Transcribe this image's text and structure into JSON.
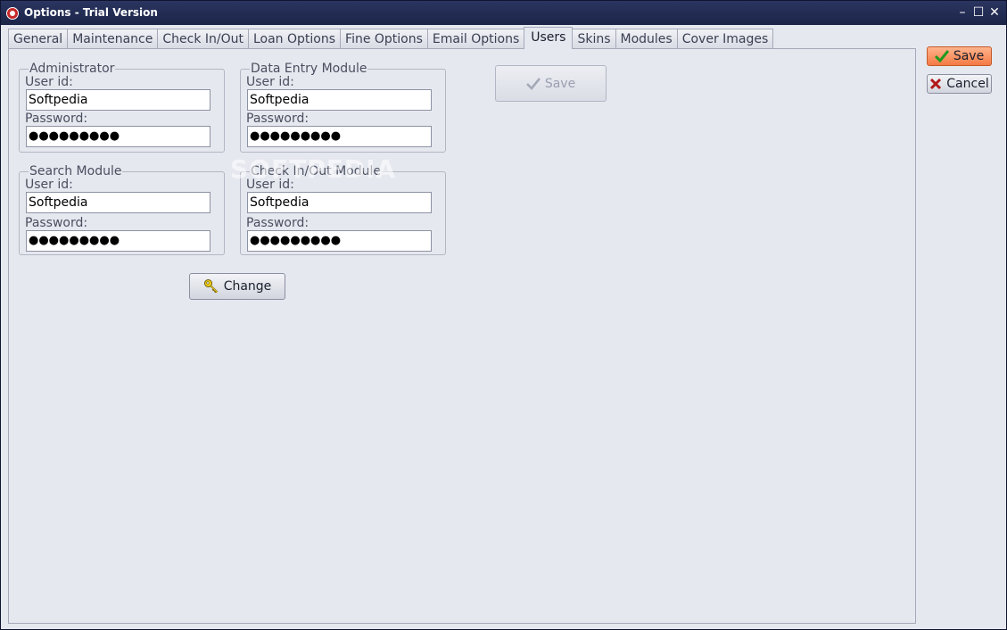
{
  "window": {
    "title": "Options - Trial Version",
    "controls": {
      "minimize": "–",
      "maximize": "☐",
      "close": "✕"
    }
  },
  "tabs": [
    {
      "label": "General"
    },
    {
      "label": "Maintenance"
    },
    {
      "label": "Check In/Out"
    },
    {
      "label": "Loan Options"
    },
    {
      "label": "Fine Options"
    },
    {
      "label": "Email Options"
    },
    {
      "label": "Users",
      "active": true
    },
    {
      "label": "Skins"
    },
    {
      "label": "Modules"
    },
    {
      "label": "Cover Images"
    }
  ],
  "groups": {
    "administrator": {
      "legend": "Administrator",
      "userid_label": "User id:",
      "userid": "Softpedia",
      "password_label": "Password:",
      "password": "●●●●●●●●●"
    },
    "data_entry": {
      "legend": "Data Entry Module",
      "userid_label": "User id:",
      "userid": "Softpedia",
      "password_label": "Password:",
      "password": "●●●●●●●●●"
    },
    "search": {
      "legend": "Search Module",
      "userid_label": "User id:",
      "userid": "Softpedia",
      "password_label": "Password:",
      "password": "●●●●●●●●●"
    },
    "checkinout": {
      "legend": "Check In/Out Module",
      "userid_label": "User id:",
      "userid": "Softpedia",
      "password_label": "Password:",
      "password": "●●●●●●●●●"
    }
  },
  "buttons": {
    "change": "Change",
    "panel_save": "Save",
    "side_save": "Save",
    "side_cancel": "Cancel"
  },
  "icons": {
    "change": "key-icon",
    "panel_save": "checkmark-icon",
    "side_save": "checkmark-icon",
    "side_cancel": "x-icon"
  },
  "colors": {
    "titlebar": "#1c2548",
    "save_accent": "#f57a45",
    "check_green": "#1e9a1e",
    "cancel_red": "#b01818"
  },
  "watermark": "SOFTPEDIA"
}
